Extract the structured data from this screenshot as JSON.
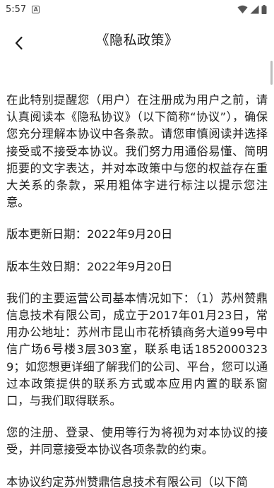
{
  "status_bar": {
    "time": "5:57",
    "notification_icon": "a-icon",
    "wifi_icon": "wifi-icon",
    "signal_icon": "signal-icon",
    "battery_icon": "battery-icon"
  },
  "header": {
    "back_icon": "chevron-left-icon",
    "title": "《隐私政策》"
  },
  "content": {
    "paragraphs": [
      "在此特别提醒您（用户）在注册成为用户之前，请认真阅读本《隐私协议》（以下简称“协议”），确保您充分理解本协议中各条款。请您审慎阅读并选择接受或不接受本协议。我们努力用通俗易懂、简明扼要的文字表达，并对本政策中与您的权益存在重大关系的条款，采用粗体字进行标注以提示您注意。",
      "版本更新日期：2022年9月20日",
      "版本生效日期：2022年9月20日",
      "我们的主要运营公司基本情况如下：（1）苏州赞鼎信息技术有限公司，成立于2017年01月23日，常用办公地址：苏州市昆山市花桥镇商务大道99号中信广场6号楼3层303室，联系电话18520003239；如您想更详细了解我们的公司、平台，您可以通过本政策提供的联系方式或本应用内置的联系窗口，与我们取得联系。",
      "您的注册、登录、使用等行为将视为对本协议的接受，并同意接受本协议各项条款的约束。",
      "本协议约定苏州赞鼎信息技术有限公司（以下简"
    ]
  },
  "colors": {
    "background": "#ffffff",
    "text": "#1f1f1f",
    "scrollbar": "#bdbdbd"
  }
}
